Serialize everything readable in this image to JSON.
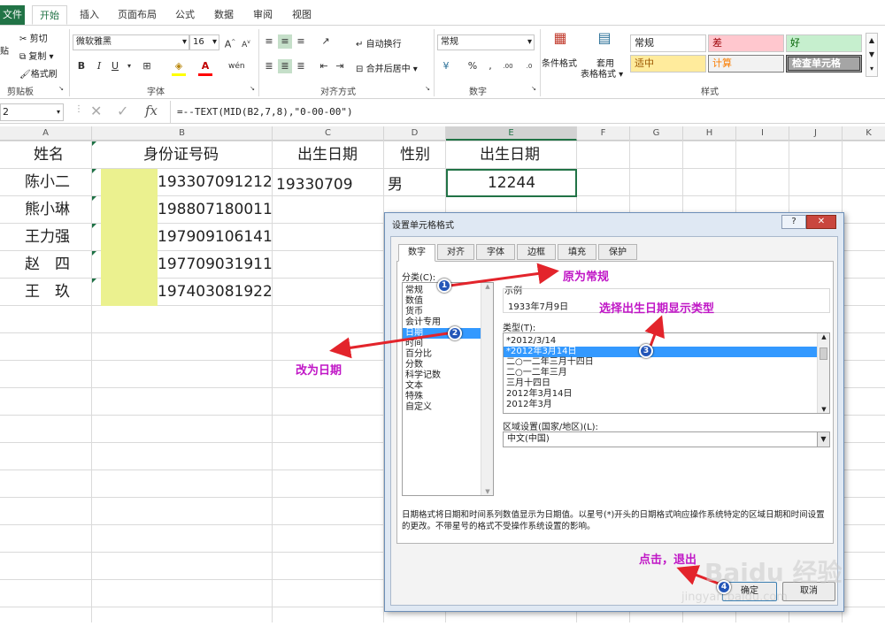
{
  "ribbon": {
    "tabs": [
      "文件",
      "开始",
      "插入",
      "页面布局",
      "公式",
      "数据",
      "审阅",
      "视图"
    ],
    "clipboard": {
      "cut": "剪切",
      "copy": "复制",
      "format_painter": "格式刷",
      "paste": "贴",
      "label": "剪贴板"
    },
    "font": {
      "name": "微软雅黑",
      "size": "16",
      "label": "字体"
    },
    "alignment": {
      "wrap": "自动换行",
      "merge": "合并后居中",
      "label": "对齐方式"
    },
    "number": {
      "format": "常规",
      "label": "数字"
    },
    "styles": {
      "conditional": "条件格式",
      "table_line1": "套用",
      "table_line2": "表格格式",
      "cells": [
        "常规",
        "差",
        "好",
        "适中",
        "计算",
        "检查单元格"
      ],
      "label": "样式"
    }
  },
  "formula_bar": {
    "name_box": "2",
    "formula": "=--TEXT(MID(B2,7,8),\"0-00-00\")"
  },
  "columns": [
    "A",
    "B",
    "C",
    "D",
    "E",
    "F",
    "G",
    "H",
    "I",
    "J",
    "K"
  ],
  "sheet": {
    "headers": [
      "姓名",
      "身份证号码",
      "出生日期",
      "性别",
      "出生日期"
    ],
    "rows": [
      {
        "name": "陈小二",
        "id": "193307091212",
        "birth": "19330709",
        "gender": "男",
        "birth2": "12244"
      },
      {
        "name": "熊小琳",
        "id": "198807180011",
        "birth": "",
        "gender": "",
        "birth2": ""
      },
      {
        "name": "王力强",
        "id": "197909106141",
        "birth": "",
        "gender": "",
        "birth2": ""
      },
      {
        "name": "赵　四",
        "id": "197709031911",
        "birth": "",
        "gender": "",
        "birth2": ""
      },
      {
        "name": "王　玖",
        "id": "197403081922",
        "birth": "",
        "gender": "",
        "birth2": ""
      }
    ]
  },
  "dialog": {
    "title": "设置单元格格式",
    "tabs": [
      "数字",
      "对齐",
      "字体",
      "边框",
      "填充",
      "保护"
    ],
    "category_label": "分类(C):",
    "categories": [
      "常规",
      "数值",
      "货币",
      "会计专用",
      "日期",
      "时间",
      "百分比",
      "分数",
      "科学记数",
      "文本",
      "特殊",
      "自定义"
    ],
    "selected_category": "日期",
    "sample_label": "示例",
    "sample_value": "1933年7月9日",
    "type_label": "类型(T):",
    "types": [
      "*2012/3/14",
      "*2012年3月14日",
      "二○一二年三月十四日",
      "二○一二年三月",
      "三月十四日",
      "2012年3月14日",
      "2012年3月"
    ],
    "selected_type": "*2012年3月14日",
    "locale_label": "区域设置(国家/地区)(L):",
    "locale_value": "中文(中国)",
    "description": "日期格式将日期和时间系列数值显示为日期值。以星号(*)开头的日期格式响应操作系统特定的区域日期和时间设置的更改。不带星号的格式不受操作系统设置的影响。",
    "ok": "确定",
    "cancel": "取消",
    "help": "?",
    "close": "✕"
  },
  "annotations": {
    "a1": "原为常规",
    "a2": "改为日期",
    "a3": "选择出生日期显示类型",
    "a4": "点击，退出"
  },
  "watermark": {
    "main": "Baidu 经验",
    "sub": "jingyan.baidu.com"
  }
}
